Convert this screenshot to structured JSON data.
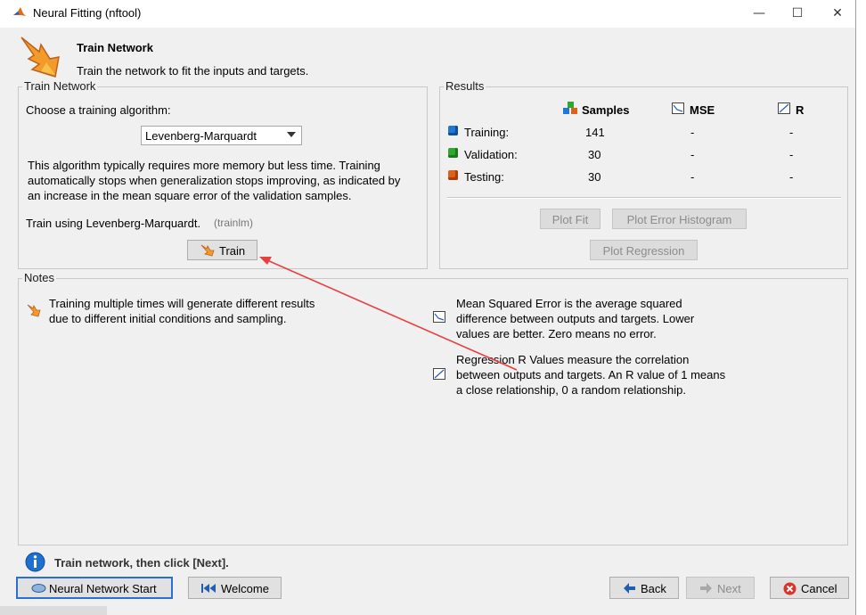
{
  "window": {
    "title": "Neural Fitting (nftool)",
    "minimize": "—",
    "maximize": "☐",
    "close": "✕"
  },
  "header": {
    "title": "Train Network",
    "subtitle": "Train the network to fit the inputs and targets."
  },
  "train_panel": {
    "legend": "Train Network",
    "choose_label": "Choose a training algorithm:",
    "algorithm": "Levenberg-Marquardt",
    "description": [
      "This algorithm typically requires more memory but less time. Training",
      "automatically stops when generalization stops improving, as indicated by",
      "an increase in the mean square error of the validation samples."
    ],
    "train_using": "Train using Levenberg-Marquardt.",
    "train_using_code": "(trainlm)",
    "train_button": "Train"
  },
  "results": {
    "legend": "Results",
    "columns": {
      "samples": "Samples",
      "mse": "MSE",
      "r": "R"
    },
    "rows": [
      {
        "label": "Training:",
        "samples": "141",
        "mse": "-",
        "r": "-",
        "color": "#1e78d7"
      },
      {
        "label": "Validation:",
        "samples": "30",
        "mse": "-",
        "r": "-",
        "color": "#2fa82f"
      },
      {
        "label": "Testing:",
        "samples": "30",
        "mse": "-",
        "r": "-",
        "color": "#e0601a"
      }
    ],
    "plot_fit": "Plot Fit",
    "plot_error_histogram": "Plot Error Histogram",
    "plot_regression": "Plot Regression"
  },
  "notes": {
    "legend": "Notes",
    "note1": [
      "Training multiple times will generate different results",
      "due to different initial conditions and sampling."
    ],
    "note2": [
      "Mean Squared Error is the average squared",
      "difference between outputs and targets. Lower",
      "values are better. Zero means no error."
    ],
    "note3": [
      "Regression R Values measure the correlation",
      "between outputs and targets. An R value of 1 means",
      "a close relationship, 0 a random relationship."
    ]
  },
  "status": {
    "message": "Train network, then click [Next]."
  },
  "footer": {
    "nn_start": "Neural Network Start",
    "welcome": "Welcome",
    "back": "Back",
    "next": "Next",
    "cancel": "Cancel"
  },
  "colors": {
    "annotation_arrow": "#e84040",
    "info_icon": "#1f6fd1",
    "cancel_icon": "#d9342b"
  }
}
